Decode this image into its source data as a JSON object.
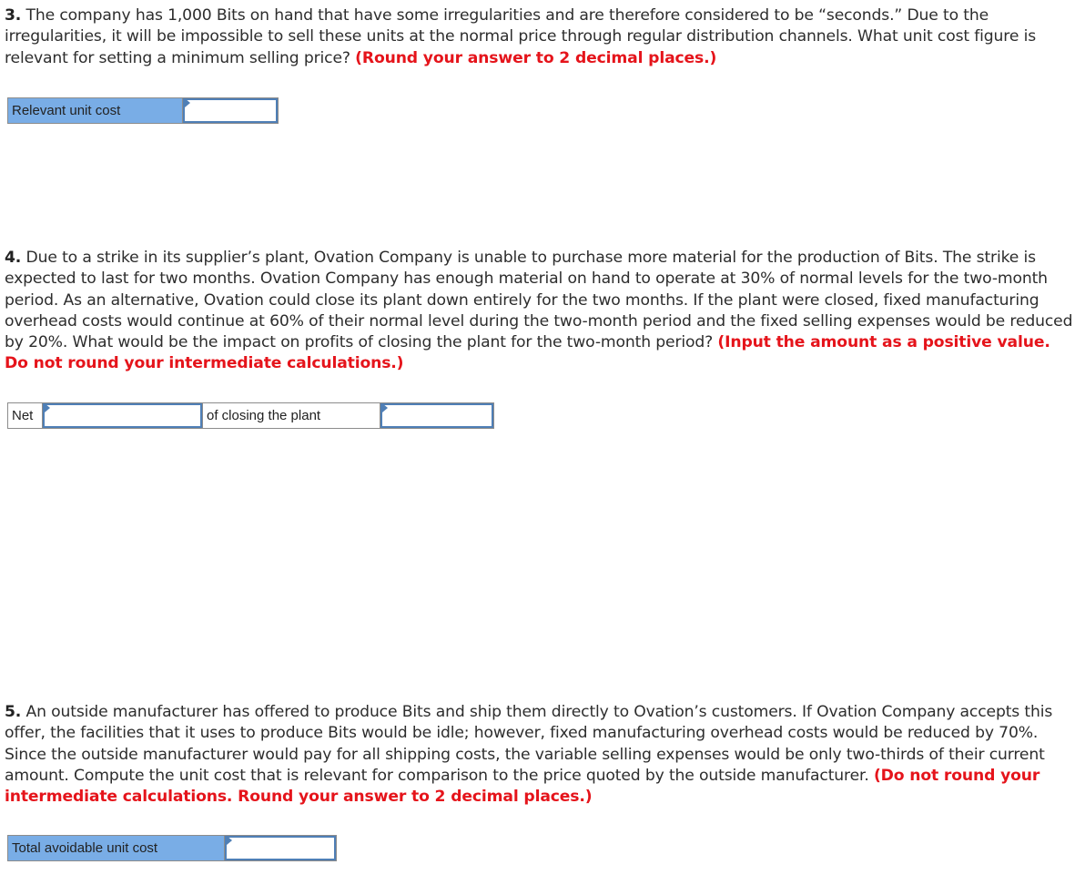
{
  "questions": [
    {
      "number": "3.",
      "text": " The company has 1,000 Bits on hand that have some irregularities and are therefore considered to be “seconds.” Due to the irregularities, it will be impossible to sell these units at the normal price through regular distribution channels. What unit cost figure is relevant for setting a minimum selling price? ",
      "note": "(Round your answer to 2 decimal places.)",
      "answer_row": {
        "label": "Relevant unit cost",
        "input_value": ""
      }
    },
    {
      "number": "4.",
      "text": " Due to a strike in its supplier’s plant, Ovation Company is unable to purchase more material for the production of Bits. The strike is expected to last for two months. Ovation Company has enough material on hand to operate at 30% of normal levels for the two-month period. As an alternative, Ovation could close its plant down entirely for the two months. If the plant were closed, fixed manufacturing overhead costs would continue at 60% of their normal level during the two-month period and the fixed selling expenses would be reduced by 20%. What would be the impact on profits of closing the plant for the two-month period? ",
      "note": "(Input the amount as a positive value. Do not round your intermediate calculations.)",
      "answer_row": {
        "label_prefix": "Net",
        "select_value": "",
        "label_middle": "of closing the plant",
        "input_value": ""
      }
    },
    {
      "number": "5.",
      "text": " An outside manufacturer has offered to produce Bits and ship them directly to Ovation’s customers. If Ovation Company accepts this offer, the facilities that it uses to produce Bits would be idle; however, fixed manufacturing overhead costs would be reduced by 70%. Since the outside manufacturer would pay for all shipping costs, the variable selling expenses would be only two-thirds of their current amount. Compute the unit cost that is relevant for comparison to the price quoted by the outside manufacturer. ",
      "note": "(Do not round your intermediate calculations. Round your answer to 2 decimal places.)",
      "answer_row": {
        "label": "Total avoidable unit cost",
        "input_value": ""
      }
    }
  ]
}
